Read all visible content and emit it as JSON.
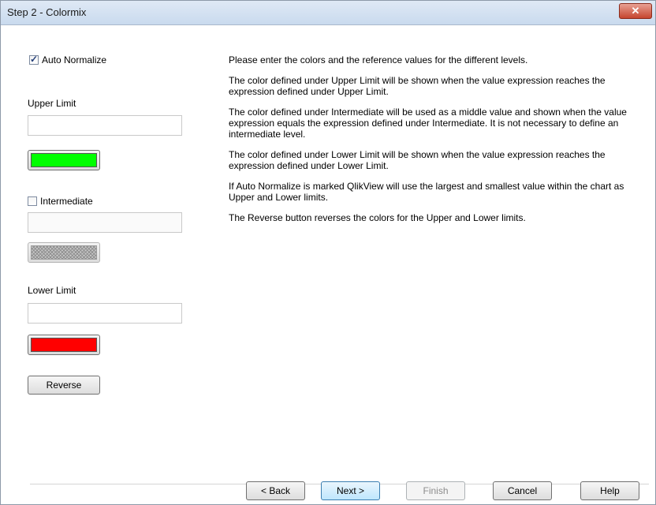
{
  "window": {
    "title": "Step 2 - Colormix",
    "close_glyph": "✕"
  },
  "auto_normalize": {
    "label": "Auto Normalize",
    "checked": true
  },
  "upper_limit": {
    "label": "Upper Limit",
    "value": "",
    "color": "#00ff00"
  },
  "intermediate": {
    "label": "Intermediate",
    "checked": false,
    "value": "",
    "color": "hatched-gray"
  },
  "lower_limit": {
    "label": "Lower Limit",
    "value": "",
    "color": "#ff0000"
  },
  "reverse_button": {
    "label": "Reverse"
  },
  "help_paragraphs": [
    "Please enter the colors and the reference values for the different levels.",
    "The color defined under Upper Limit will be shown when the value expression reaches the expression defined under Upper Limit.",
    "The color defined under Intermediate will be used as a middle value and shown when the value expression equals the expression defined under Intermediate. It is not necessary to define an intermediate level.",
    "The color defined under Lower Limit will be shown when the value expression reaches the expression defined under Lower Limit.",
    "If Auto Normalize is marked QlikView will use the largest and smallest value within the chart as Upper and Lower limits.",
    "The Reverse button reverses the colors for the Upper and Lower limits."
  ],
  "footer": {
    "back": "< Back",
    "next": "Next >",
    "finish": "Finish",
    "cancel": "Cancel",
    "help": "Help"
  }
}
